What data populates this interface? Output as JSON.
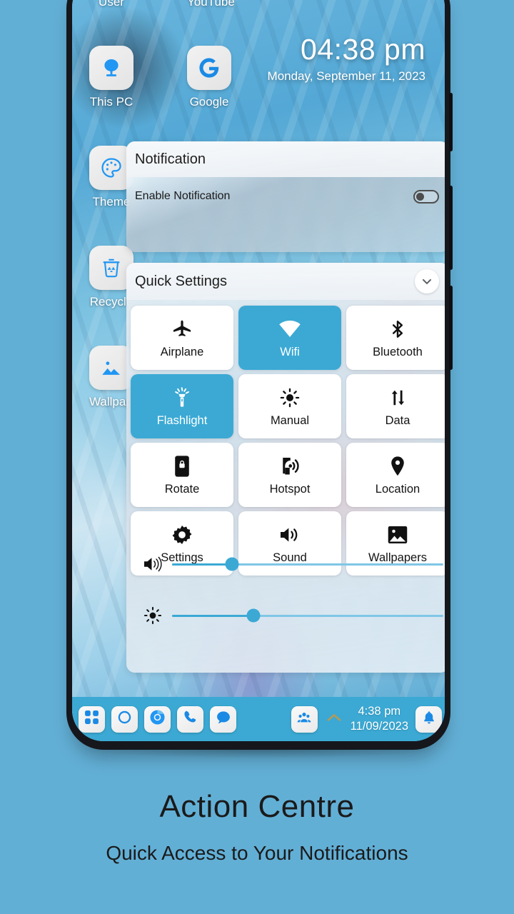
{
  "theme": {
    "page_bg": "#62afd6",
    "accent": "#3ba9d4",
    "taskbar_bg": "#3ba9d4",
    "tile_bg": "#ffffff",
    "frame": "#15171c"
  },
  "clock_widget": {
    "time": "04:38 pm",
    "date": "Monday, September 11, 2023"
  },
  "desktop_icons": [
    {
      "label": "User",
      "icon": "user-icon"
    },
    {
      "label": "YouTube",
      "icon": "youtube-icon"
    },
    {
      "label": "This PC",
      "icon": "this-pc-icon"
    },
    {
      "label": "Google",
      "icon": "google-icon"
    },
    {
      "label": "Theme",
      "icon": "palette-icon"
    },
    {
      "label": "Recycle",
      "icon": "recycle-bin-icon"
    },
    {
      "label": "Wallpaper",
      "icon": "wallpaper-image-icon"
    }
  ],
  "notification_panel": {
    "title": "Notification",
    "row_label": "Enable Notification",
    "toggle_state": "off"
  },
  "quick_settings": {
    "title": "Quick Settings",
    "collapse_icon": "chevron-down-icon",
    "tiles": [
      {
        "label": "Airplane",
        "icon": "airplane-icon",
        "active": false
      },
      {
        "label": "Wifi",
        "icon": "wifi-icon",
        "active": true
      },
      {
        "label": "Bluetooth",
        "icon": "bluetooth-icon",
        "active": false
      },
      {
        "label": "Flashlight",
        "icon": "flashlight-icon",
        "active": true
      },
      {
        "label": "Manual",
        "icon": "brightness-icon",
        "active": false
      },
      {
        "label": "Data",
        "icon": "data-arrows-icon",
        "active": false
      },
      {
        "label": "Rotate",
        "icon": "rotate-lock-icon",
        "active": false
      },
      {
        "label": "Hotspot",
        "icon": "hotspot-icon",
        "active": false
      },
      {
        "label": "Location",
        "icon": "location-pin-icon",
        "active": false
      },
      {
        "label": "Settings",
        "icon": "gear-icon",
        "active": false
      },
      {
        "label": "Sound",
        "icon": "speaker-icon",
        "active": false
      },
      {
        "label": "Wallpapers",
        "icon": "image-icon",
        "active": false
      }
    ],
    "sliders": [
      {
        "name": "volume",
        "icon": "volume-icon",
        "percent": 22
      },
      {
        "name": "brightness",
        "icon": "brightness-icon",
        "percent": 30
      }
    ]
  },
  "taskbar": {
    "left_icons": [
      {
        "name": "start-button",
        "icon": "start-squares-icon"
      },
      {
        "name": "cortana-button",
        "icon": "circle-icon"
      },
      {
        "name": "chrome-button",
        "icon": "chrome-icon"
      },
      {
        "name": "phone-button",
        "icon": "phone-icon"
      },
      {
        "name": "messages-button",
        "icon": "message-bubble-icon"
      }
    ],
    "right_icons": [
      {
        "name": "people-button",
        "icon": "people-icon"
      },
      {
        "name": "tray-expand",
        "icon": "chevron-up-icon"
      }
    ],
    "clock_time": "4:38 pm",
    "clock_date": "11/09/2023",
    "notification_icon": "bell-icon"
  },
  "caption": {
    "title": "Action Centre",
    "subtitle": "Quick Access to Your Notifications"
  }
}
